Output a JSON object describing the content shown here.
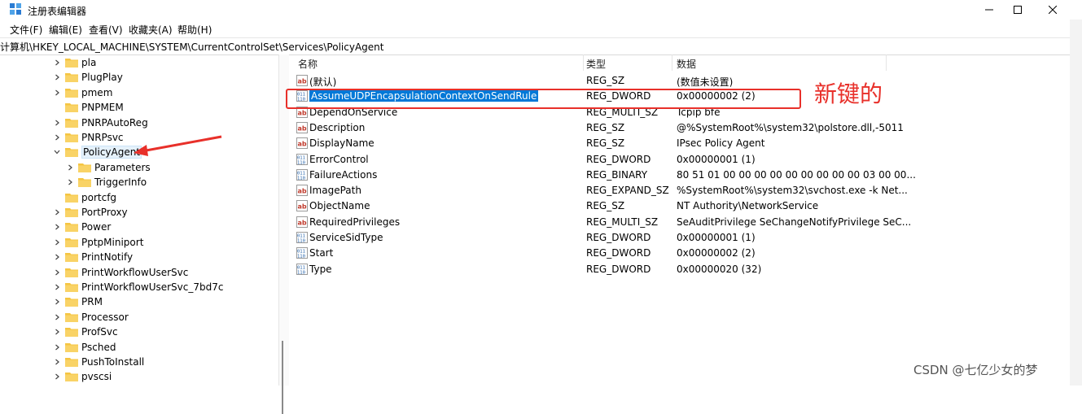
{
  "window": {
    "title": "注册表编辑器",
    "minimize": "—",
    "maximize": "☐",
    "close": "✕"
  },
  "menu": [
    "文件(F)",
    "编辑(E)",
    "查看(V)",
    "收藏夹(A)",
    "帮助(H)"
  ],
  "address": "计算机\\HKEY_LOCAL_MACHINE\\SYSTEM\\CurrentControlSet\\Services\\PolicyAgent",
  "tree": [
    {
      "label": "pla",
      "expandable": true
    },
    {
      "label": "PlugPlay",
      "expandable": true
    },
    {
      "label": "pmem",
      "expandable": true
    },
    {
      "label": "PNPMEM",
      "expandable": false
    },
    {
      "label": "PNRPAutoReg",
      "expandable": true
    },
    {
      "label": "PNRPsvc",
      "expandable": true
    },
    {
      "label": "PolicyAgent",
      "expandable": true,
      "expanded": true,
      "selected": true
    },
    {
      "label": "Parameters",
      "expandable": true,
      "child": true
    },
    {
      "label": "TriggerInfo",
      "expandable": true,
      "child": true
    },
    {
      "label": "portcfg",
      "expandable": false
    },
    {
      "label": "PortProxy",
      "expandable": true
    },
    {
      "label": "Power",
      "expandable": true
    },
    {
      "label": "PptpMiniport",
      "expandable": true
    },
    {
      "label": "PrintNotify",
      "expandable": true
    },
    {
      "label": "PrintWorkflowUserSvc",
      "expandable": true
    },
    {
      "label": "PrintWorkflowUserSvc_7bd7c",
      "expandable": true
    },
    {
      "label": "PRM",
      "expandable": true
    },
    {
      "label": "Processor",
      "expandable": true
    },
    {
      "label": "ProfSvc",
      "expandable": true
    },
    {
      "label": "Psched",
      "expandable": true
    },
    {
      "label": "PushToInstall",
      "expandable": true
    },
    {
      "label": "pvscsi",
      "expandable": true
    }
  ],
  "columns": {
    "name": "名称",
    "type": "类型",
    "data": "数据"
  },
  "values": [
    {
      "icon": "string-value-icon",
      "name": "(默认)",
      "type": "REG_SZ",
      "data": "(数值未设置)"
    },
    {
      "icon": "binary-value-icon",
      "name": "AssumeUDPEncapsulationContextOnSendRule",
      "type": "REG_DWORD",
      "data": "0x00000002 (2)",
      "selected": true
    },
    {
      "icon": "string-value-icon",
      "name": "DependOnService",
      "type": "REG_MULTI_SZ",
      "data": "Tcpip bfe"
    },
    {
      "icon": "string-value-icon",
      "name": "Description",
      "type": "REG_SZ",
      "data": "@%SystemRoot%\\system32\\polstore.dll,-5011"
    },
    {
      "icon": "string-value-icon",
      "name": "DisplayName",
      "type": "REG_SZ",
      "data": "IPsec Policy Agent"
    },
    {
      "icon": "binary-value-icon",
      "name": "ErrorControl",
      "type": "REG_DWORD",
      "data": "0x00000001 (1)"
    },
    {
      "icon": "binary-value-icon",
      "name": "FailureActions",
      "type": "REG_BINARY",
      "data": "80 51 01 00 00 00 00 00 00 00 00 00 03 00 00..."
    },
    {
      "icon": "string-value-icon",
      "name": "ImagePath",
      "type": "REG_EXPAND_SZ",
      "data": "%SystemRoot%\\system32\\svchost.exe -k Net..."
    },
    {
      "icon": "string-value-icon",
      "name": "ObjectName",
      "type": "REG_SZ",
      "data": "NT Authority\\NetworkService"
    },
    {
      "icon": "string-value-icon",
      "name": "RequiredPrivileges",
      "type": "REG_MULTI_SZ",
      "data": "SeAuditPrivilege SeChangeNotifyPrivilege SeC..."
    },
    {
      "icon": "binary-value-icon",
      "name": "ServiceSidType",
      "type": "REG_DWORD",
      "data": "0x00000001 (1)"
    },
    {
      "icon": "binary-value-icon",
      "name": "Start",
      "type": "REG_DWORD",
      "data": "0x00000002 (2)"
    },
    {
      "icon": "binary-value-icon",
      "name": "Type",
      "type": "REG_DWORD",
      "data": "0x00000020 (32)"
    }
  ],
  "annotation": "新键的",
  "watermark": "CSDN @七亿少女的梦",
  "colors": {
    "accent": "#0078d7",
    "annotation": "#e8302a",
    "folder": "#f5c542"
  }
}
